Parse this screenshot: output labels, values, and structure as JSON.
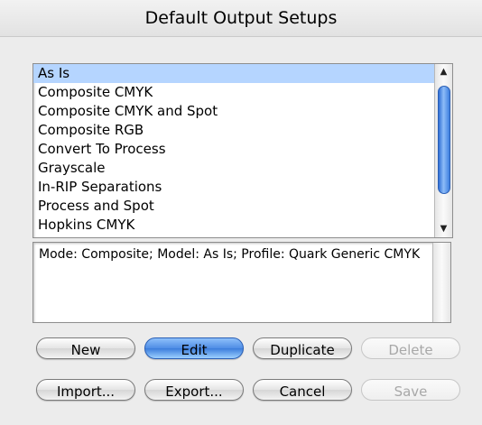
{
  "dialog": {
    "title": "Default Output Setups"
  },
  "list": {
    "items": [
      "As Is",
      "Composite CMYK",
      "Composite CMYK and Spot",
      "Composite RGB",
      "Convert To Process",
      "Grayscale",
      "In-RIP Separations",
      "Process and Spot",
      "Hopkins CMYK"
    ],
    "selected": "As Is",
    "scroll_up_icon": "▲",
    "scroll_down_icon": "▼"
  },
  "description": "Mode: Composite; Model: As Is; Profile: Quark Generic CMYK",
  "buttons": {
    "new": "New",
    "edit": "Edit",
    "duplicate": "Duplicate",
    "delete": "Delete",
    "import": "Import...",
    "export": "Export...",
    "cancel": "Cancel",
    "save": "Save"
  },
  "colors": {
    "selection": "#b5d5ff",
    "default_button": "#4f8de6"
  }
}
